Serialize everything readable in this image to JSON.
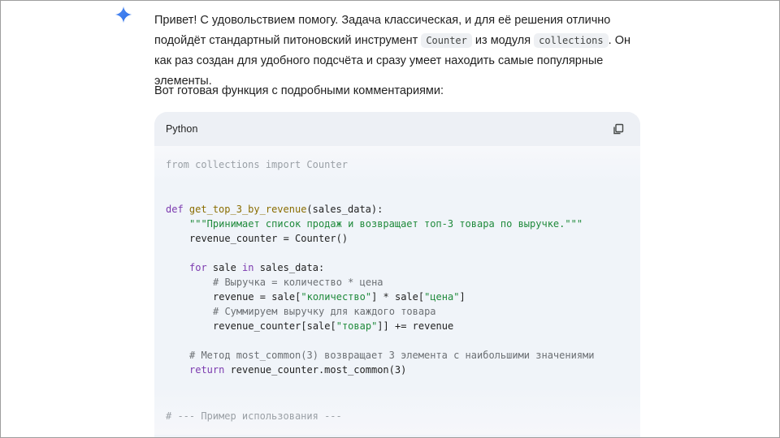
{
  "assistant": {
    "icon": "gemini-spark-icon",
    "accent_color": "#4285f4",
    "intro": {
      "text_a": "Привет! С удовольствием помогу. Задача классическая, и для её решения отлично подойдёт стандартный питоновский инструмент ",
      "chip_1": "Counter",
      "text_b": " из модуля ",
      "chip_2": "collections",
      "text_c": ". Он как раз создан для удобного подсчёта и сразу умеет находить самые популярные элементы."
    },
    "lead_in": "Вот готовая функция с подробными комментариями:"
  },
  "code_block": {
    "language": "Python",
    "copy_icon": "copy-icon",
    "line_import": "from collections import Counter",
    "def_kw": "def",
    "func_name": "get_top_3_by_revenue",
    "def_rest": "(sales_data):",
    "docstring": "\"\"\"Принимает список продаж и возвращает топ-3 товара по выручке.\"\"\"",
    "line_counter": "revenue_counter = Counter()",
    "for_kw": "for",
    "for_var": " sale ",
    "in_kw": "in",
    "for_rest": " sales_data:",
    "comment_1": "# Выручка = количество * цена",
    "rev_a": "revenue = sale[",
    "rev_str1": "\"количество\"",
    "rev_b": "] * sale[",
    "rev_str2": "\"цена\"",
    "rev_c": "]",
    "comment_2": "# Суммируем выручку для каждого товара",
    "acc_a": "revenue_counter[sale[",
    "acc_str": "\"товар\"",
    "acc_b": "]] += revenue",
    "comment_3": "# Метод most_common(3) возвращает 3 элемента с наибольшими значениями",
    "return_kw": "return",
    "return_rest": " revenue_counter.most_common(3)",
    "comment_4": "# --- Пример использования ---"
  }
}
